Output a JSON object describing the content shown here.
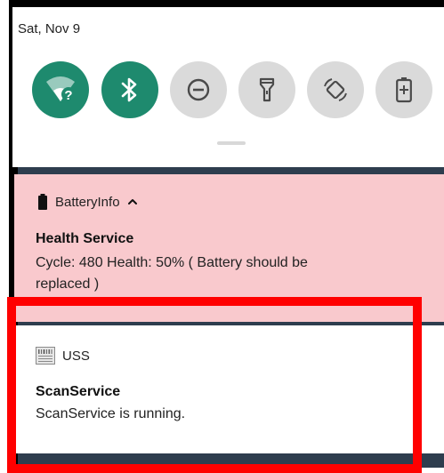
{
  "status_bar": {
    "date": "Sat, Nov 9"
  },
  "quick_settings": {
    "tiles": [
      {
        "icon": "wifi-question-icon",
        "state": "on"
      },
      {
        "icon": "bluetooth-icon",
        "state": "on"
      },
      {
        "icon": "do-not-disturb-icon",
        "state": "off"
      },
      {
        "icon": "flashlight-icon",
        "state": "off"
      },
      {
        "icon": "auto-rotate-icon",
        "state": "off"
      },
      {
        "icon": "battery-saver-icon",
        "state": "off"
      }
    ],
    "colors": {
      "tile_on": "#1e8a6e",
      "tile_off": "#dadada"
    }
  },
  "notifications": {
    "battery": {
      "app_name": "BatteryInfo",
      "app_icon": "battery-icon",
      "expand_icon": "chevron-up-icon",
      "title": "Health Service",
      "text_line1": "Cycle: 480  Health: 50%  ( Battery should be",
      "text_line2": "replaced )",
      "background": "#f9c9cd"
    },
    "scan": {
      "app_name": "USS",
      "app_icon": "barcode-icon",
      "title": "ScanService",
      "text": "ScanService is running."
    }
  },
  "highlight": {
    "color": "#ff0000"
  }
}
